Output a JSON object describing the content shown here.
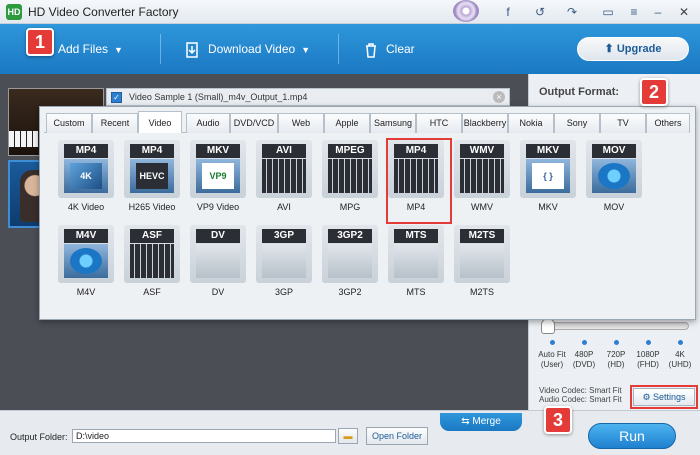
{
  "window": {
    "title": "HD Video Converter Factory",
    "app_icon": "HD"
  },
  "toolbar": {
    "add_files": "Add Files",
    "download_video": "Download Video",
    "clear": "Clear",
    "upgrade": "Upgrade"
  },
  "steps": [
    "1",
    "2",
    "3"
  ],
  "file_list": {
    "filename": "Video Sample 1 (Small)_m4v_Output_1.mp4"
  },
  "format_popup": {
    "tabs": [
      "Custom",
      "Recent",
      "Video",
      "Audio",
      "DVD/VCD",
      "Web",
      "Apple",
      "Samsung",
      "HTC",
      "Blackberry",
      "Nokia",
      "Sony",
      "TV",
      "Others"
    ],
    "active_tab": "Video",
    "formats": [
      {
        "head": "MP4",
        "inner": "4K",
        "label": "4K Video"
      },
      {
        "head": "MP4",
        "inner": "HEVC",
        "label": "H265 Video"
      },
      {
        "head": "MKV",
        "inner": "VP9",
        "label": "VP9 Video"
      },
      {
        "head": "AVI",
        "inner": "",
        "label": "AVI"
      },
      {
        "head": "MPEG",
        "inner": "",
        "label": "MPG"
      },
      {
        "head": "MP4",
        "inner": "",
        "label": "MP4"
      },
      {
        "head": "WMV",
        "inner": "",
        "label": "WMV"
      },
      {
        "head": "MKV",
        "inner": "{ }",
        "label": "MKV"
      },
      {
        "head": "MOV",
        "inner": "",
        "label": "MOV"
      },
      {
        "head": "M4V",
        "inner": "",
        "label": "M4V"
      },
      {
        "head": "ASF",
        "inner": "",
        "label": "ASF"
      },
      {
        "head": "DV",
        "inner": "",
        "label": "DV"
      },
      {
        "head": "3GP",
        "inner": "",
        "label": "3GP"
      },
      {
        "head": "3GP2",
        "inner": "",
        "label": "3GP2"
      },
      {
        "head": "MTS",
        "inner": "",
        "label": "MTS"
      },
      {
        "head": "M2TS",
        "inner": "",
        "label": "M2TS"
      }
    ],
    "selected": "MP4"
  },
  "right_panel": {
    "output_format_label": "Output Format:",
    "resolutions": [
      {
        "line1": "Auto Fit",
        "line2": "(User)"
      },
      {
        "line1": "480P",
        "line2": "(DVD)"
      },
      {
        "line1": "720P",
        "line2": "(HD)"
      },
      {
        "line1": "1080P",
        "line2": "(FHD)"
      },
      {
        "line1": "4K",
        "line2": "(UHD)"
      }
    ],
    "video_codec": "Video Codec: Smart Fit",
    "audio_codec": "Audio Codec: Smart Fit",
    "settings": "Settings"
  },
  "bottom": {
    "output_folder_label": "Output Folder:",
    "output_folder_value": "D:\\video",
    "open_folder": "Open Folder",
    "merge": "Merge",
    "run": "Run"
  },
  "colors": {
    "toolbar_blue": "#1a78c2",
    "highlight_red": "#e43b38"
  }
}
